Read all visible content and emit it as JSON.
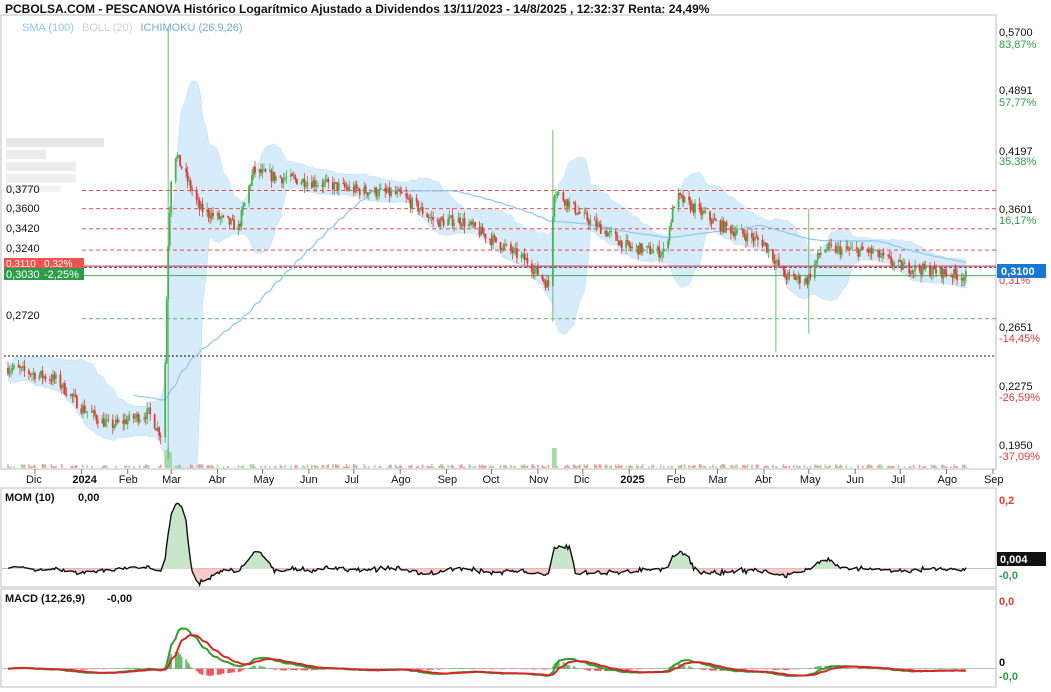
{
  "header": {
    "title": "PCBOLSA.COM - PESCANOVA Histórico Logarítmico Ajustado a Dividendos 13/11/2023 - 14/8/2025 , 12:32:37 Renta: 24,49%",
    "legend": [
      "SMA (100)",
      "BOLL (20)",
      "ICHIMOKU (26,9,26)"
    ]
  },
  "colors": {
    "up": "#4caf50",
    "down": "#e53935",
    "band": "#d6ecfb",
    "sma": "#8cc8ef",
    "line_green": "#2e9d48",
    "line_red": "#e53935",
    "mom": "#111111",
    "macd": "#2ca02c",
    "signal": "#d62728"
  },
  "main_axis": {
    "right_ticks": [
      {
        "price": "0,5700",
        "pct": "83,87%",
        "color": "#2e9d48"
      },
      {
        "price": "0,4891",
        "pct": "57,77%",
        "color": "#2e9d48"
      },
      {
        "price": "0,4197",
        "pct": "35,38%",
        "color": "#2e9d48"
      },
      {
        "price": "0,3601",
        "pct": "16,17%",
        "color": "#2e9d48"
      },
      {
        "price": "0,2651",
        "pct": "-14,45%",
        "color": "#e53935"
      },
      {
        "price": "0,2275",
        "pct": "-26,59%",
        "color": "#e53935"
      },
      {
        "price": "0,1950",
        "pct": "-37,09%",
        "color": "#e53935"
      }
    ],
    "current_price": "0,3100",
    "hidden_pct": "0,31%",
    "left_levels": [
      "0,3770",
      "0,3600",
      "0,3420",
      "0,3240",
      "0,2720"
    ],
    "tag_high": {
      "price": "0,3110",
      "pct": "0,32%"
    },
    "tag_low": {
      "price": "0,3030",
      "pct": "-2,25%"
    }
  },
  "months": [
    "Dic",
    "2024",
    "Feb",
    "Mar",
    "Abr",
    "May",
    "Jun",
    "Jul",
    "Ago",
    "Sep",
    "Oct",
    "Nov",
    "Dic",
    "2025",
    "Feb",
    "Mar",
    "Abr",
    "May",
    "Jun",
    "Jul",
    "Ago",
    "Sep"
  ],
  "mom_panel": {
    "label": "MOM (10)",
    "value": "0,00",
    "axis_top": "0,2",
    "axis_bottom": "-0,0",
    "current": "0,004"
  },
  "macd_panel": {
    "label": "MACD (12,26,9)",
    "value": "-0,00",
    "axis_top": "0,0",
    "axis_mid": "0",
    "axis_bottom": "-0,0"
  },
  "chart_data": {
    "type": "candlestick",
    "y_scale": "log",
    "x_start": "2023-11-13",
    "x_end": "2025-08-14",
    "ylim": [
      0.186,
      0.585
    ],
    "price_path": [
      {
        "date": "2023-11-15",
        "close": 0.24
      },
      {
        "date": "2023-12-15",
        "close": 0.233
      },
      {
        "date": "2024-01-01",
        "close": 0.217
      },
      {
        "date": "2024-01-20",
        "close": 0.207
      },
      {
        "date": "2024-02-15",
        "close": 0.214
      },
      {
        "date": "2024-02-25",
        "close": 0.2
      },
      {
        "date": "2024-02-28",
        "close": 0.33
      },
      {
        "date": "2024-03-02",
        "close": 0.42
      },
      {
        "date": "2024-03-20",
        "close": 0.36
      },
      {
        "date": "2024-04-15",
        "close": 0.343
      },
      {
        "date": "2024-04-25",
        "close": 0.396
      },
      {
        "date": "2024-05-10",
        "close": 0.39
      },
      {
        "date": "2024-06-01",
        "close": 0.386
      },
      {
        "date": "2024-07-01",
        "close": 0.378
      },
      {
        "date": "2024-08-01",
        "close": 0.373
      },
      {
        "date": "2024-08-25",
        "close": 0.348
      },
      {
        "date": "2024-09-10",
        "close": 0.35
      },
      {
        "date": "2024-10-01",
        "close": 0.333
      },
      {
        "date": "2024-10-25",
        "close": 0.315
      },
      {
        "date": "2024-11-08",
        "close": 0.296
      },
      {
        "date": "2024-11-12",
        "close": 0.377
      },
      {
        "date": "2024-12-01",
        "close": 0.353
      },
      {
        "date": "2025-01-01",
        "close": 0.326
      },
      {
        "date": "2025-01-25",
        "close": 0.322
      },
      {
        "date": "2025-02-01",
        "close": 0.372
      },
      {
        "date": "2025-03-01",
        "close": 0.346
      },
      {
        "date": "2025-04-01",
        "close": 0.33
      },
      {
        "date": "2025-04-15",
        "close": 0.303
      },
      {
        "date": "2025-04-30",
        "close": 0.3
      },
      {
        "date": "2025-05-10",
        "close": 0.325
      },
      {
        "date": "2025-06-10",
        "close": 0.323
      },
      {
        "date": "2025-07-01",
        "close": 0.311
      },
      {
        "date": "2025-08-14",
        "close": 0.303
      }
    ],
    "last_close": 0.31,
    "mom_range": [
      -0.05,
      0.25
    ],
    "macd_range": [
      -0.02,
      0.1
    ]
  }
}
